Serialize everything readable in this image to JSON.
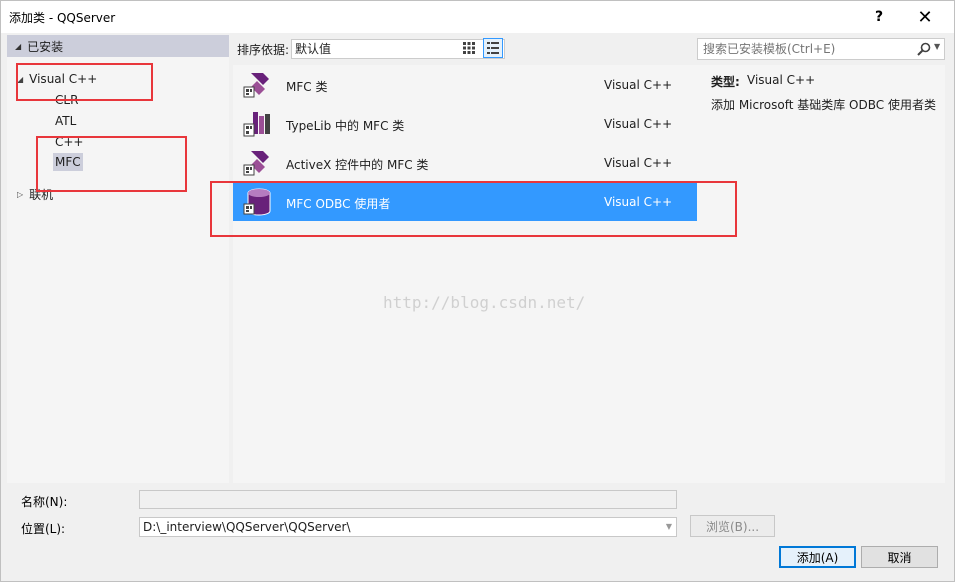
{
  "window": {
    "title": "添加类 - QQServer",
    "help_label": "?",
    "close_label": "✕"
  },
  "left_panel": {
    "installed_label": "已安装",
    "visual_cpp_label": "Visual C++",
    "children": [
      "CLR",
      "ATL",
      "C++",
      "MFC"
    ],
    "online_label": "联机"
  },
  "toolbar": {
    "sort_label": "排序依据:",
    "sort_value": "默认值"
  },
  "templates": [
    {
      "name": "MFC 类",
      "lang": "Visual C++",
      "icon": "mfc-class-icon"
    },
    {
      "name": "TypeLib 中的 MFC 类",
      "lang": "Visual C++",
      "icon": "typelib-icon"
    },
    {
      "name": "ActiveX 控件中的 MFC 类",
      "lang": "Visual C++",
      "icon": "activex-icon"
    },
    {
      "name": "MFC ODBC 使用者",
      "lang": "Visual C++",
      "icon": "odbc-database-icon",
      "selected": true
    }
  ],
  "watermark": "http://blog.csdn.net/",
  "search": {
    "placeholder": "搜索已安装模板(Ctrl+E)"
  },
  "details": {
    "type_label": "类型:",
    "type_value": "Visual C++",
    "description": "添加 Microsoft 基础类库 ODBC 使用者类"
  },
  "form": {
    "name_label": "名称(N):",
    "name_value": "",
    "location_label": "位置(L):",
    "location_value": "D:\\_interview\\QQServer\\QQServer\\",
    "browse_label": "浏览(B)...",
    "add_label": "添加(A)",
    "cancel_label": "取消"
  },
  "colors": {
    "selection": "#3399ff",
    "annotation_red": "#e8363b",
    "header_bg": "#cccedb",
    "vs_purple": "#68217a"
  }
}
